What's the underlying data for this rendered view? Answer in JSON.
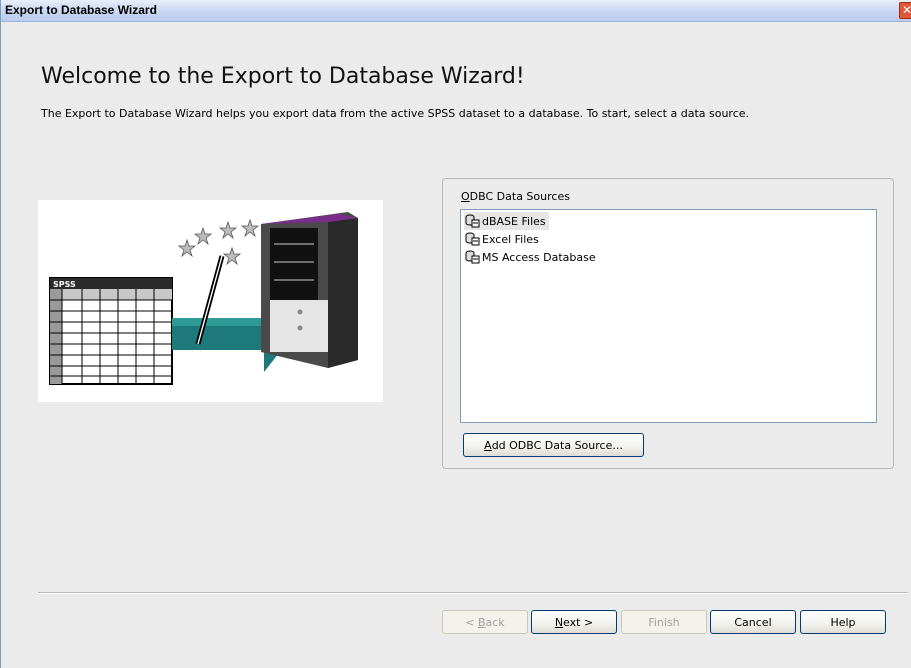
{
  "window": {
    "title": "Export to Database Wizard",
    "close_glyph": "✕"
  },
  "main": {
    "heading": "Welcome to the Export to Database Wizard!",
    "intro": "The Export to Database Wizard helps you export data from the active SPSS dataset to a database. To start, select a data source.",
    "illustration": {
      "sheet_label": "SPSS"
    }
  },
  "data_sources": {
    "label_mnemonic": "O",
    "label_rest": "DBC Data Sources",
    "items": [
      {
        "label": "dBASE Files",
        "icon": "database-icon",
        "selected": true
      },
      {
        "label": "Excel Files",
        "icon": "database-icon",
        "selected": false
      },
      {
        "label": "MS Access Database",
        "icon": "database-icon",
        "selected": false
      }
    ],
    "add_button_mnemonic": "A",
    "add_button_rest": "dd ODBC Data Source..."
  },
  "footer": {
    "back": {
      "pre": "< ",
      "mnemonic": "B",
      "post": "ack",
      "enabled": false
    },
    "next": {
      "mnemonic": "N",
      "post": "ext >",
      "enabled": true
    },
    "finish": {
      "label": "Finish",
      "enabled": false
    },
    "cancel": {
      "label": "Cancel",
      "enabled": true
    },
    "help": {
      "label": "Help",
      "enabled": true
    }
  },
  "colors": {
    "arrow": "#1e7a7a",
    "server_top": "#7a2e8c",
    "title_bar": "#c9d7f1"
  }
}
